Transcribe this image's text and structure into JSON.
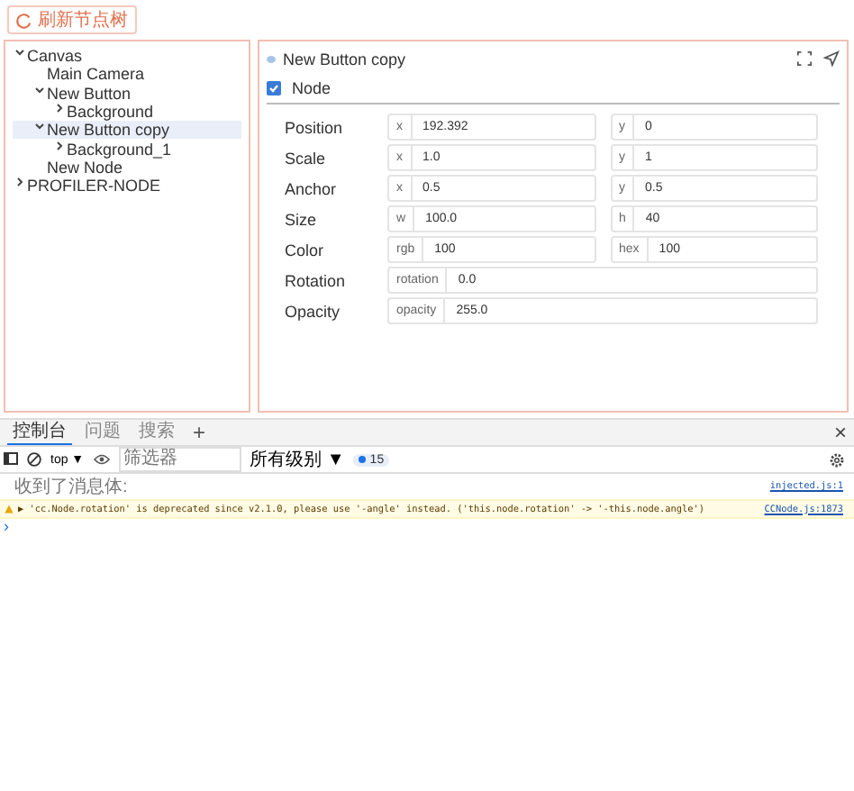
{
  "toolbar": {
    "refresh_button": "刷新节点树"
  },
  "tree": {
    "items": [
      {
        "label": "Canvas",
        "expanded": true,
        "selected": false,
        "children": [
          {
            "label": "Main Camera",
            "selected": false
          },
          {
            "label": "New Button",
            "expanded": true,
            "selected": false,
            "children": [
              {
                "label": "Background",
                "expanded": false,
                "selected": false
              }
            ]
          },
          {
            "label": "New Button copy",
            "expanded": true,
            "selected": true,
            "children": [
              {
                "label": "Background_1",
                "expanded": false,
                "selected": false
              }
            ]
          },
          {
            "label": "New Node",
            "selected": false
          }
        ]
      },
      {
        "label": "PROFILER-NODE",
        "expanded": false,
        "selected": false
      }
    ]
  },
  "inspector": {
    "title": "New Button copy",
    "component": {
      "label": "Node",
      "checked": true
    },
    "properties": [
      {
        "label": "Position",
        "fields": [
          {
            "prefix": "x",
            "value": "192.392"
          },
          {
            "prefix": "y",
            "value": "0"
          }
        ]
      },
      {
        "label": "Scale",
        "fields": [
          {
            "prefix": "x",
            "value": "1.0"
          },
          {
            "prefix": "y",
            "value": "1"
          }
        ]
      },
      {
        "label": "Anchor",
        "fields": [
          {
            "prefix": "x",
            "value": "0.5"
          },
          {
            "prefix": "y",
            "value": "0.5"
          }
        ]
      },
      {
        "label": "Size",
        "fields": [
          {
            "prefix": "w",
            "value": "100.0"
          },
          {
            "prefix": "h",
            "value": "40"
          }
        ]
      },
      {
        "label": "Color",
        "fields": [
          {
            "prefix": "rgb",
            "value": "100"
          },
          {
            "prefix": "hex",
            "value": "100"
          }
        ]
      },
      {
        "label": "Rotation",
        "fields": [
          {
            "prefix": "rotation",
            "value": "0.0"
          }
        ]
      },
      {
        "label": "Opacity",
        "fields": [
          {
            "prefix": "opacity",
            "value": "255.0"
          }
        ]
      }
    ]
  },
  "console": {
    "tabs": [
      {
        "label": "控制台",
        "selected": true
      },
      {
        "label": "问题",
        "selected": false
      },
      {
        "label": "搜索",
        "selected": false
      }
    ],
    "add_tab": "+",
    "close": "×",
    "context": "top ▼",
    "filter": {
      "placeholder": "筛选器"
    },
    "levels": "所有级别 ▼",
    "message_count": "15",
    "messages": [
      {
        "kind": "info",
        "text": "收到了消息体:",
        "source": "injected.js:1"
      },
      {
        "kind": "warning",
        "text": "▶ 'cc.Node.rotation' is deprecated since v2.1.0, please use '-angle' instead. ('this.node.rotation' -> '-this.node.angle')",
        "source": "CCNode.js:1873"
      }
    ],
    "prompt": "›"
  }
}
